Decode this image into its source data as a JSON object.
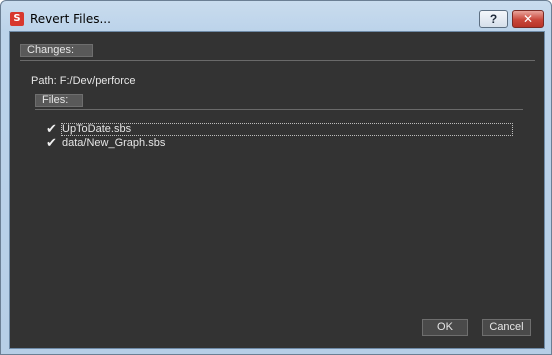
{
  "window": {
    "title": "Revert Files...",
    "app_icon": "substance-logo-icon",
    "help_label": "?",
    "close_label": "✕"
  },
  "changes": {
    "header": "Changes:",
    "path_label": "Path: F:/Dev/perforce"
  },
  "files": {
    "header": "Files:",
    "items": [
      {
        "label": "UpToDate.sbs",
        "checked": true
      },
      {
        "label": "data/New_Graph.sbs",
        "checked": true
      }
    ]
  },
  "buttons": {
    "ok_label": "OK",
    "cancel_label": "Cancel"
  },
  "colors": {
    "panel_bg": "#333333",
    "titlebar": "#bcd3ea",
    "close_button": "#c9473b"
  }
}
